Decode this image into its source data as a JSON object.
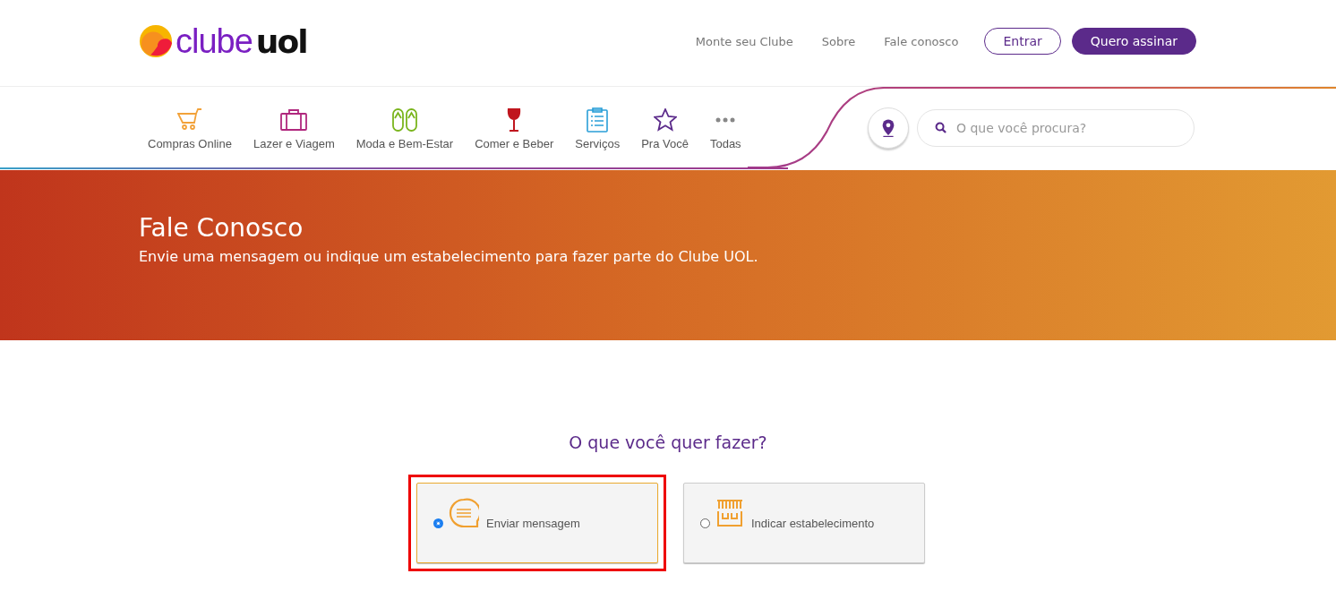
{
  "logo": {
    "part_1": "clube",
    "part_2": "uol"
  },
  "top_links": [
    "Monte seu Clube",
    "Sobre",
    "Fale conosco"
  ],
  "buttons": [
    {
      "label": "Entrar",
      "kind": "outline"
    },
    {
      "label": "Quero assinar",
      "kind": "filled"
    }
  ],
  "categories": [
    {
      "label": "Compras Online"
    },
    {
      "label": "Lazer e Viagem"
    },
    {
      "label": "Moda e Bem-Estar"
    },
    {
      "label": "Comer e Beber"
    },
    {
      "label": "Serviços"
    },
    {
      "label": "Pra Você"
    },
    {
      "label": "Todas"
    }
  ],
  "search": {
    "placeholder": "O que você procura?"
  },
  "banner": {
    "title": "Fale Conosco",
    "subtitle": "Envie uma mensagem ou indique um estabelecimento para fazer parte do Clube UOL."
  },
  "question": "O que você quer fazer?",
  "options": [
    {
      "label": "Enviar mensagem",
      "selected": true,
      "highlighted": true
    },
    {
      "label": "Indicar estabelecimento",
      "selected": false,
      "highlighted": false
    }
  ]
}
